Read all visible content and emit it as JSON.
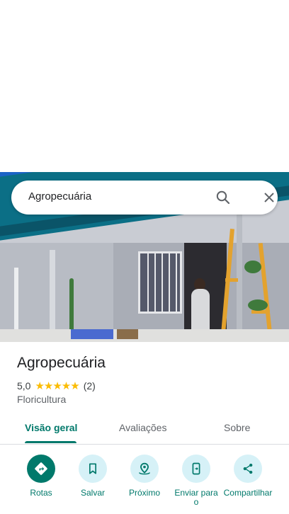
{
  "search": {
    "query": "Agropecuária"
  },
  "place": {
    "title": "Agropecuária",
    "rating": "5,0",
    "stars": "★★★★★",
    "reviews": "(2)",
    "category": "Floricultura"
  },
  "tabs": [
    {
      "label": "Visão geral",
      "active": true
    },
    {
      "label": "Avaliações",
      "active": false
    },
    {
      "label": "Sobre",
      "active": false
    }
  ],
  "actions": [
    {
      "label": "Rotas",
      "icon": "directions-icon"
    },
    {
      "label": "Salvar",
      "icon": "bookmark-icon"
    },
    {
      "label": "Próximo",
      "icon": "nearby-icon"
    },
    {
      "label": "Enviar para o",
      "icon": "send-to-phone-icon"
    },
    {
      "label": "Compartilhar",
      "icon": "share-icon"
    }
  ],
  "colors": {
    "accent": "#00796b",
    "chip": "#d6f1f7",
    "star": "#fbbc04"
  }
}
